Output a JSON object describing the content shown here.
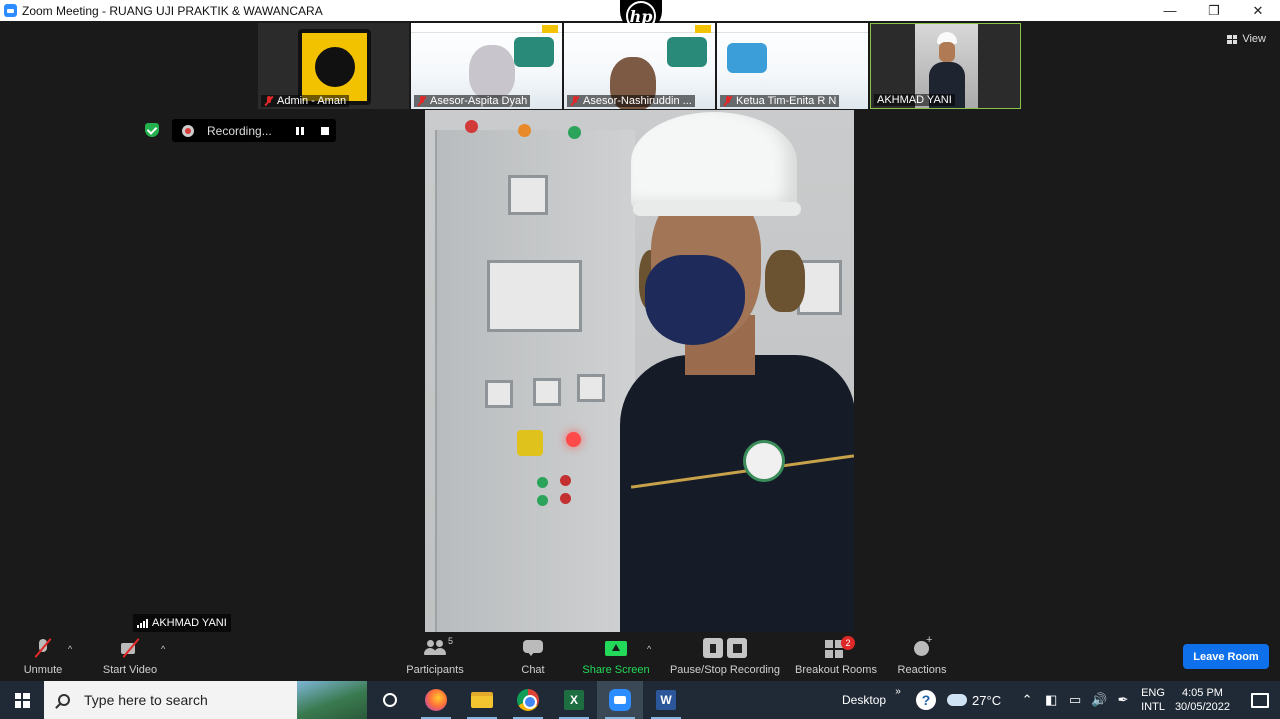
{
  "window": {
    "title": "Zoom Meeting - RUANG UJI PRAKTIK & WAWANCARA",
    "controls": [
      "minimize",
      "restore",
      "close"
    ]
  },
  "participants_strip": [
    {
      "name": "Admin - Aman",
      "muted": true
    },
    {
      "name": "Asesor-Aspita Dyah",
      "muted": true
    },
    {
      "name": "Asesor-Nashiruddin ...",
      "muted": true
    },
    {
      "name": "Ketua Tim-Enita R N",
      "muted": true
    },
    {
      "name": "AKHMAD YANI",
      "muted": false,
      "active_speaker": true
    }
  ],
  "view_button": "View",
  "recording": {
    "label": "Recording...",
    "status_color": "#23b14d"
  },
  "main_video": {
    "speaker_name": "AKHMAD YANI"
  },
  "toolbar": {
    "unmute": "Unmute",
    "start_video": "Start Video",
    "participants": "Participants",
    "participants_count": "5",
    "chat": "Chat",
    "share_screen": "Share Screen",
    "pause_stop_recording": "Pause/Stop Recording",
    "breakout_rooms": "Breakout Rooms",
    "breakout_badge": "2",
    "reactions": "Reactions",
    "leave": "Leave Room",
    "accent_color": "#0e71eb",
    "share_color": "#23d959"
  },
  "taskbar": {
    "search_placeholder": "Type here to search",
    "apps": [
      "cortana-icon",
      "firefox-icon",
      "file-explorer-icon",
      "chrome-icon",
      "excel-icon",
      "zoom-icon",
      "word-icon"
    ],
    "desktop_label": "Desktop",
    "weather": "27°C",
    "lang_top": "ENG",
    "lang_bottom": "INTL",
    "time": "4:05 PM",
    "date": "30/05/2022"
  }
}
